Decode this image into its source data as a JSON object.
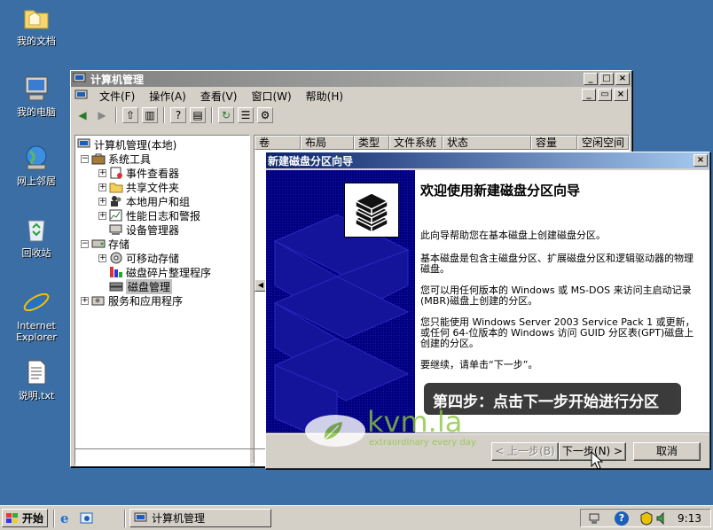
{
  "desktop": {
    "icons": [
      {
        "label": "我的文档",
        "icon": "my-documents-icon"
      },
      {
        "label": "我的电脑",
        "icon": "my-computer-icon"
      },
      {
        "label": "网上邻居",
        "icon": "network-places-icon"
      },
      {
        "label": "回收站",
        "icon": "recycle-bin-icon"
      },
      {
        "label": "Internet Explorer",
        "icon": "ie-icon"
      },
      {
        "label": "说明.txt",
        "icon": "text-file-icon"
      }
    ]
  },
  "mmc": {
    "title": "计算机管理",
    "menu": [
      "文件(F)",
      "操作(A)",
      "查看(V)",
      "窗口(W)",
      "帮助(H)"
    ],
    "tree": [
      {
        "label": "计算机管理(本地)",
        "depth": 0
      },
      {
        "label": "系统工具",
        "depth": 1,
        "expander": "−"
      },
      {
        "label": "事件查看器",
        "depth": 2,
        "expander": "+"
      },
      {
        "label": "共享文件夹",
        "depth": 2,
        "expander": "+"
      },
      {
        "label": "本地用户和组",
        "depth": 2,
        "expander": "+"
      },
      {
        "label": "性能日志和警报",
        "depth": 2,
        "expander": "+"
      },
      {
        "label": "设备管理器",
        "depth": 2,
        "expander": ""
      },
      {
        "label": "存储",
        "depth": 1,
        "expander": "−"
      },
      {
        "label": "可移动存储",
        "depth": 2,
        "expander": "+"
      },
      {
        "label": "磁盘碎片整理程序",
        "depth": 2,
        "expander": ""
      },
      {
        "label": "磁盘管理",
        "depth": 2,
        "expander": "",
        "selected": true
      },
      {
        "label": "服务和应用程序",
        "depth": 1,
        "expander": "+"
      }
    ],
    "columns": [
      "卷",
      "布局",
      "类型",
      "文件系统",
      "状态",
      "容量",
      "空闲空间"
    ]
  },
  "wizard": {
    "title": "新建磁盘分区向导",
    "heading": "欢迎使用新建磁盘分区向导",
    "p1": "此向导帮助您在基本磁盘上创建磁盘分区。",
    "p2": "基本磁盘是包含主磁盘分区、扩展磁盘分区和逻辑驱动器的物理磁盘。",
    "p3": "您可以用任何版本的 Windows 或 MS-DOS 来访问主启动记录(MBR)磁盘上创建的分区。",
    "p4": "您只能使用 Windows Server 2003 Service Pack 1 或更新，或任何 64-位版本的 Windows 访问 GUID 分区表(GPT)磁盘上创建的分区。",
    "p5": "要继续，请单击“下一步”。",
    "back_label": "< 上一步(B)",
    "next_label": "下一步(N) >",
    "cancel_label": "取消"
  },
  "overlay": {
    "step_text": "第四步：点击下一步开始进行分区",
    "watermark_brand": "kvm.la",
    "watermark_tagline": "extraordinary every day"
  },
  "taskbar": {
    "start_label": "开始",
    "task_label": "计算机管理",
    "clock": "9:13"
  },
  "colors": {
    "desktop": "#3a6ea5",
    "active_title": "#0a246a",
    "wizard_banner": "#000080",
    "step_banner": "#2b2b2b",
    "brand_green": "#8cc63f"
  }
}
